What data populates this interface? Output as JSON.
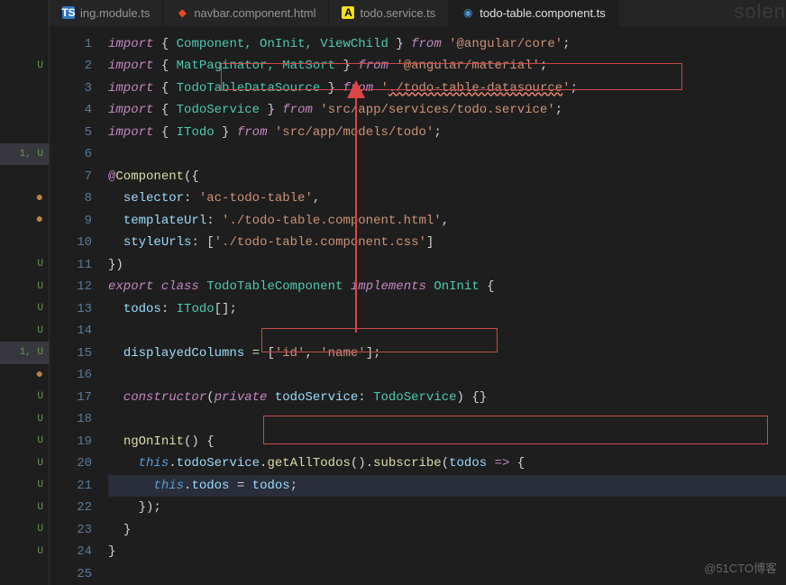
{
  "tabs": [
    {
      "label": "ing.module.ts",
      "iconType": "ts"
    },
    {
      "label": "navbar.component.html",
      "iconType": "html"
    },
    {
      "label": "todo.service.ts",
      "iconType": "js"
    },
    {
      "label": "todo-table.component.ts",
      "iconType": "ng",
      "active": true
    }
  ],
  "gitGutter": [
    "",
    "U",
    "",
    "",
    "",
    "1, U",
    "",
    "●",
    "●",
    "",
    "U",
    "U",
    "U",
    "U",
    "1, U",
    "●",
    "U",
    "U",
    "U",
    "U",
    "U",
    "U",
    "U",
    "U",
    ""
  ],
  "lineNumbers": [
    "1",
    "2",
    "3",
    "4",
    "5",
    "6",
    "7",
    "8",
    "9",
    "10",
    "11",
    "12",
    "13",
    "14",
    "15",
    "16",
    "17",
    "18",
    "19",
    "20",
    "21",
    "22",
    "23",
    "24",
    "25"
  ],
  "code": {
    "l1": {
      "import": "import",
      "lb": "{ ",
      "names": "Component, OnInit, ViewChild",
      "rb": " }",
      "from": "from",
      "str": "'@angular/core'",
      "end": ";"
    },
    "l2": {
      "import": "import",
      "lb": "{ ",
      "names": "MatPaginator, MatSort",
      "rb": " }",
      "from": "from",
      "str": "'@angular/material'",
      "end": ";"
    },
    "l3": {
      "import": "import",
      "lb": "{ ",
      "names": "TodoTableDataSource",
      "rb": " }",
      "from": "from",
      "str1": "'",
      "strerr": "./todo-table-datasource",
      "str2": "'",
      "end": ";"
    },
    "l4": {
      "import": "import",
      "lb": "{ ",
      "names": "TodoService",
      "rb": " }",
      "from": "from",
      "str": "'src/app/services/todo.service'",
      "end": ";"
    },
    "l5": {
      "import": "import",
      "lb": "{ ",
      "names": "ITodo",
      "rb": " }",
      "from": "from",
      "str": "'src/app/models/todo'",
      "end": ";"
    },
    "l7": {
      "dec": "@",
      "name": "Component",
      "paren": "({"
    },
    "l8": {
      "prop": "selector",
      "col": ": ",
      "str": "'ac-todo-table'",
      "end": ","
    },
    "l9": {
      "prop": "templateUrl",
      "col": ": ",
      "str": "'./todo-table.component.html'",
      "end": ","
    },
    "l10": {
      "prop": "styleUrls",
      "col": ": [",
      "str": "'./todo-table.component.css'",
      "end": "]"
    },
    "l11": {
      "text": "})"
    },
    "l12": {
      "export": "export",
      "class": "class",
      "name": "TodoTableComponent",
      "impl": "implements",
      "iface": "OnInit",
      "brace": " {"
    },
    "l13": {
      "prop": "todos",
      "col": ": ",
      "type": "ITodo",
      "arr": "[];"
    },
    "l15": {
      "prop": "displayedColumns",
      "eq": " = [",
      "s1": "'id'",
      "comma": ", ",
      "s2": "'name'",
      "end": "];"
    },
    "l17": {
      "ctor": "constructor",
      "lp": "(",
      "priv": "private",
      "sp": " ",
      "param": "todoService",
      "col": ": ",
      "type": "TodoService",
      "rp": ") {}"
    },
    "l19": {
      "fn": "ngOnInit",
      "paren": "() {"
    },
    "l20": {
      "this": "this",
      "dot1": ".",
      "prop1": "todoService",
      "dot2": ".",
      "fn1": "getAllTodos",
      "p1": "().",
      "fn2": "subscribe",
      "lp": "(",
      "param": "todos",
      "arrow": " => ",
      "brace": "{"
    },
    "l21": {
      "this": "this",
      "dot": ".",
      "prop": "todos",
      "eq": " = ",
      "val": "todos",
      "end": ";"
    },
    "l22": {
      "text": "});"
    },
    "l23": {
      "text": "}"
    },
    "l24": {
      "text": "}"
    }
  },
  "watermark": "@51CTO博客",
  "brand": "solen"
}
